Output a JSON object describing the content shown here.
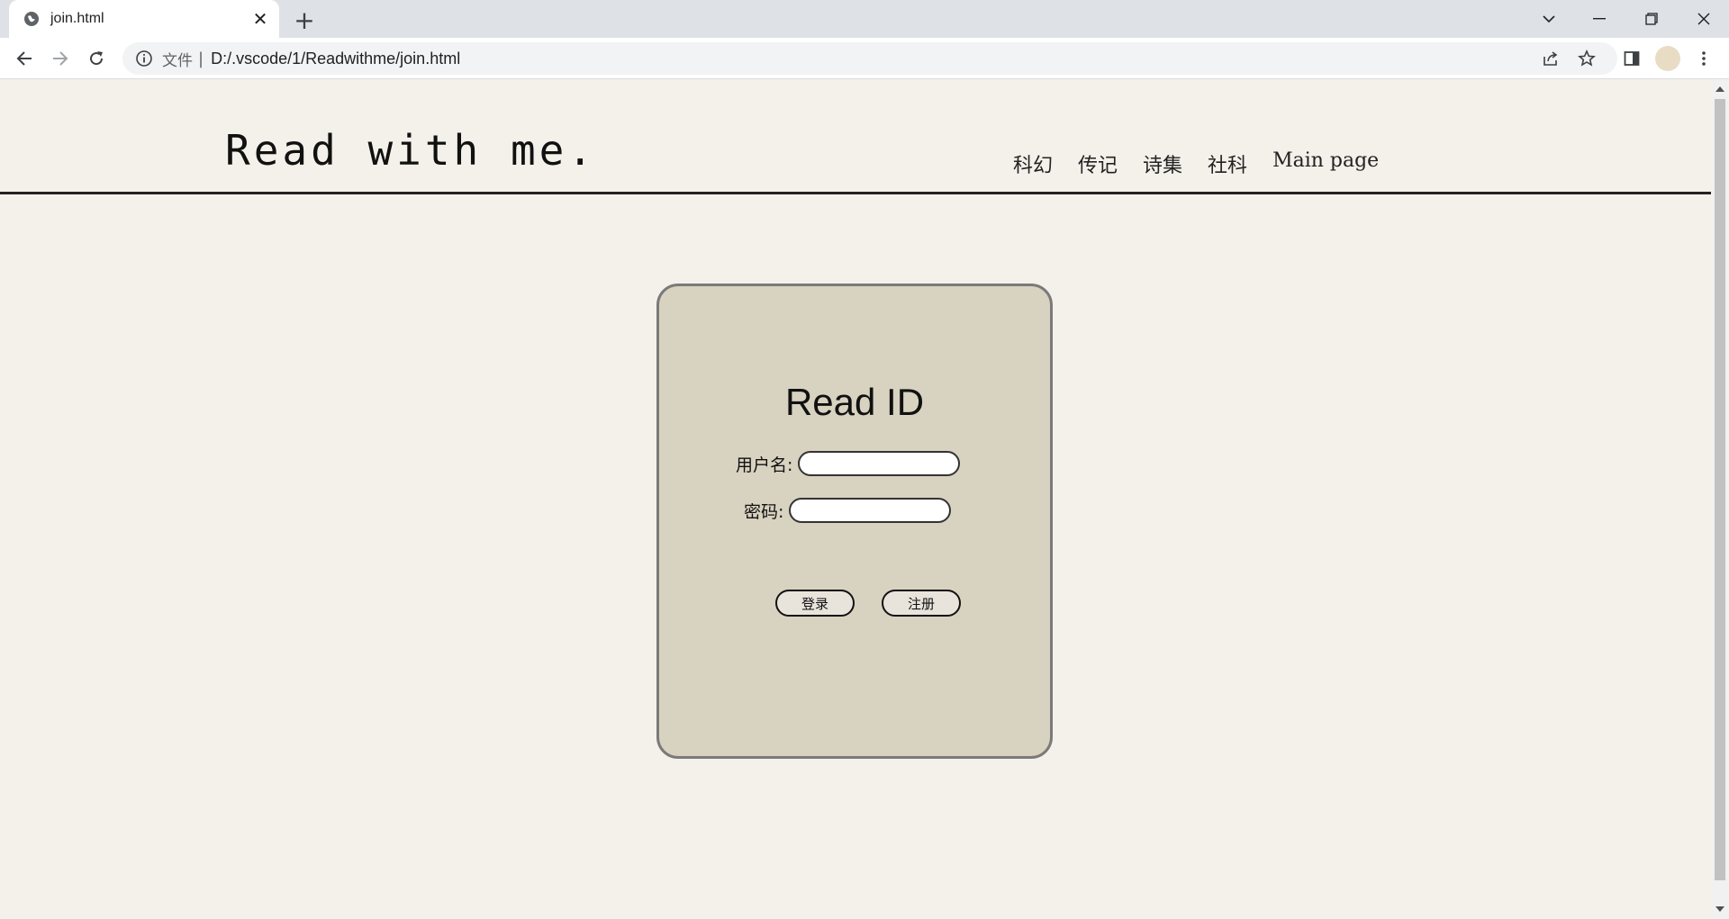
{
  "browser": {
    "tab_title": "join.html",
    "scheme_label": "文件",
    "url": "D:/.vscode/1/Readwithme/join.html"
  },
  "site": {
    "logo": "Read with me.",
    "nav": [
      "科幻",
      "传记",
      "诗集",
      "社科",
      "Main page"
    ]
  },
  "login": {
    "title": "Read ID",
    "username_label": "用户名:",
    "password_label": "密码:",
    "username_value": "",
    "password_value": "",
    "login_button": "登录",
    "register_button": "注册"
  },
  "colors": {
    "page_bg": "#f4f0ea",
    "card_bg": "#d8d2c0",
    "card_border": "#7a7a7a"
  }
}
